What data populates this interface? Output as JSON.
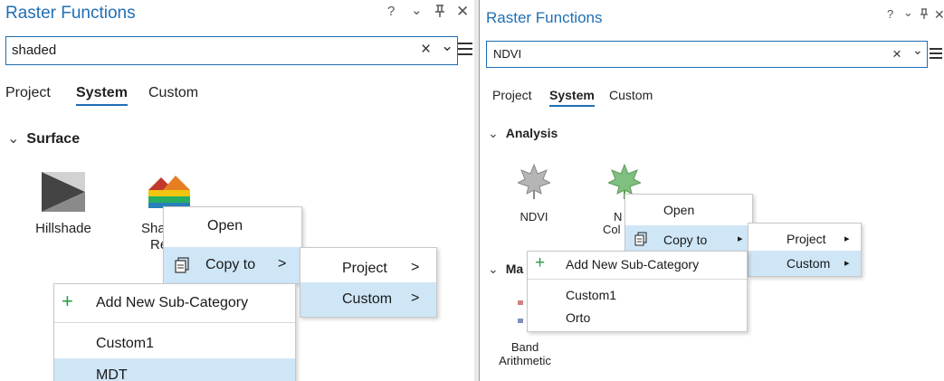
{
  "left_panel": {
    "title": "Raster Functions",
    "controls": {
      "help": "?",
      "dropdown": "⌄",
      "pin": "ꟷ",
      "close": "✕"
    },
    "search": {
      "value": "shaded",
      "clear": "×",
      "dropdown": "⌄"
    },
    "tabs": [
      {
        "label": "Project"
      },
      {
        "label": "System"
      },
      {
        "label": "Custom"
      }
    ],
    "category": {
      "label": "Surface"
    },
    "items": [
      {
        "label": "Hillshade",
        "icon": "hillshade-icon"
      },
      {
        "label_line1": "Sha",
        "label_line2": "Re",
        "icon": "shaded-relief-icon"
      }
    ],
    "context_menu": {
      "open": "Open",
      "copy_to": "Copy to",
      "arrow": ">"
    },
    "copy_submenu": {
      "project": "Project",
      "custom": "Custom",
      "arrow": ">"
    },
    "custom_submenu": {
      "add": "Add New Sub-Category",
      "plus": "+",
      "item1": "Custom1",
      "item2": "MDT"
    }
  },
  "right_panel": {
    "title": "Raster Functions",
    "controls": {
      "help": "?",
      "dropdown": "⌄",
      "pin": "ꟷ",
      "close": "✕"
    },
    "search": {
      "value": "NDVI",
      "clear": "×",
      "dropdown": "⌄"
    },
    "tabs": [
      {
        "label": "Project"
      },
      {
        "label": "System"
      },
      {
        "label": "Custom"
      }
    ],
    "category": {
      "label": "Analysis"
    },
    "category2": {
      "label": "Ma"
    },
    "items": [
      {
        "label": "NDVI",
        "icon": "leaf-gray-icon"
      },
      {
        "label_line1": "N",
        "label_line2": "Col",
        "icon": "leaf-green-icon"
      }
    ],
    "band_item": {
      "label_line1": "Band",
      "label_line2": "Arithmetic"
    },
    "context_menu": {
      "open": "Open",
      "copy_to": "Copy to",
      "arrow": "▸"
    },
    "copy_submenu": {
      "project": "Project",
      "custom": "Custom",
      "arrow": "▸"
    },
    "custom_submenu": {
      "add": "Add New Sub-Category",
      "plus": "+",
      "item1": "Custom1",
      "item2": "Orto"
    }
  }
}
